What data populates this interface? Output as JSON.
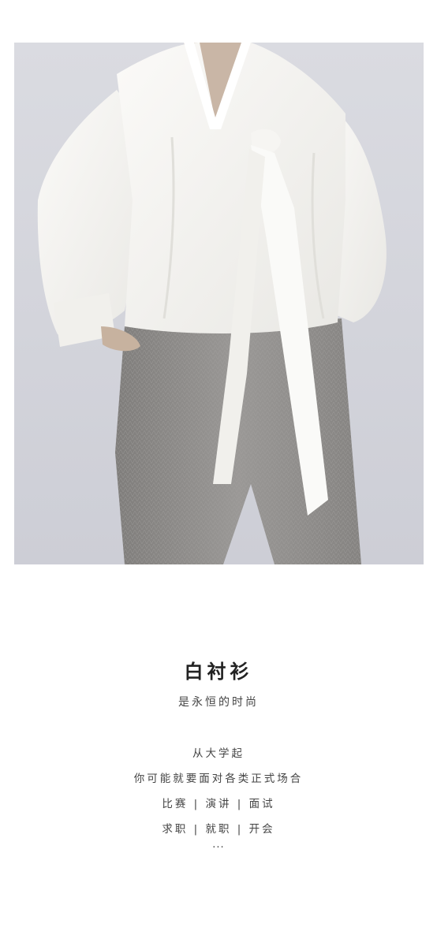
{
  "photo": {
    "alt": "white-blouse-with-tie-and-grey-trousers"
  },
  "text": {
    "title": "白衬衫",
    "subtitle": "是永恒的时尚",
    "lines": [
      "从大学起",
      "你可能就要面对各类正式场合",
      "比赛 | 演讲 | 面试",
      "求职 | 就职 | 开会"
    ],
    "ellipsis": "..."
  },
  "colors": {
    "background": "#ffffff",
    "photo_backdrop": "#d4d5dc",
    "blouse": "#f4f3f0",
    "trousers": "#8e8c8a",
    "text": "#444444"
  }
}
